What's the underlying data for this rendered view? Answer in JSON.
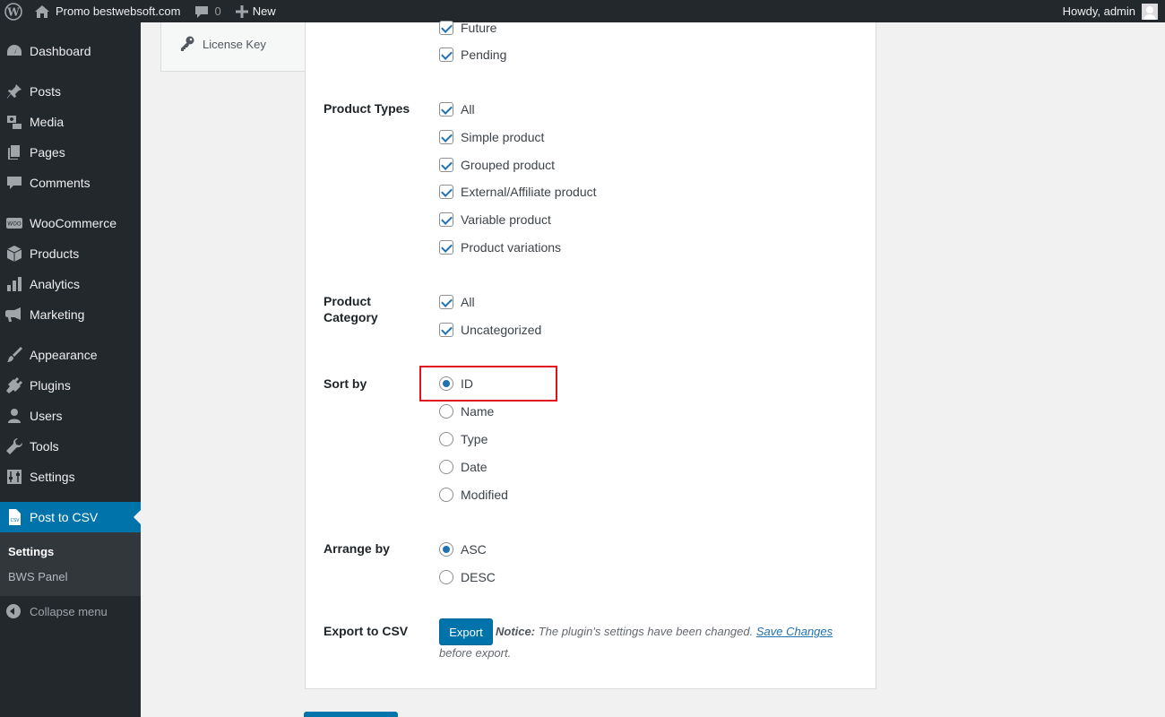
{
  "adminbar": {
    "site_name": "Promo bestwebsoft.com",
    "comments_count": "0",
    "new_label": "New",
    "howdy": "Howdy, admin"
  },
  "sidebar": {
    "items": [
      {
        "label": "Dashboard",
        "icon": "dashboard-icon"
      },
      {
        "label": "Posts",
        "icon": "pin-icon"
      },
      {
        "label": "Media",
        "icon": "media-icon"
      },
      {
        "label": "Pages",
        "icon": "pages-icon"
      },
      {
        "label": "Comments",
        "icon": "comment-icon"
      },
      {
        "label": "WooCommerce",
        "icon": "woo-icon"
      },
      {
        "label": "Products",
        "icon": "box-icon"
      },
      {
        "label": "Analytics",
        "icon": "bar-chart-icon"
      },
      {
        "label": "Marketing",
        "icon": "megaphone-icon"
      },
      {
        "label": "Appearance",
        "icon": "brush-icon"
      },
      {
        "label": "Plugins",
        "icon": "plug-icon"
      },
      {
        "label": "Users",
        "icon": "user-icon"
      },
      {
        "label": "Tools",
        "icon": "wrench-icon"
      },
      {
        "label": "Settings",
        "icon": "sliders-icon"
      },
      {
        "label": "Post to CSV",
        "icon": "csv-file-icon"
      }
    ],
    "submenu": [
      "Settings",
      "BWS Panel"
    ],
    "collapse": "Collapse menu"
  },
  "tabs": {
    "license": "License Key"
  },
  "form": {
    "post_status_opts": [
      "Future",
      "Pending"
    ],
    "product_types_label": "Product Types",
    "product_types": [
      "All",
      "Simple product",
      "Grouped product",
      "External/Affiliate product",
      "Variable product",
      "Product variations"
    ],
    "product_category_label": "Product Category",
    "product_category": [
      "All",
      "Uncategorized"
    ],
    "sort_by_label": "Sort by",
    "sort_by": [
      "ID",
      "Name",
      "Type",
      "Date",
      "Modified"
    ],
    "sort_by_selected": "ID",
    "arrange_by_label": "Arrange by",
    "arrange_by": [
      "ASC",
      "DESC"
    ],
    "arrange_by_selected": "ASC",
    "export_label": "Export to CSV",
    "export_button": "Export",
    "notice_prefix": "Notice:",
    "notice_text": "The plugin's settings have been changed.",
    "notice_link": "Save Changes",
    "notice_suffix": "before export."
  },
  "colors": {
    "accent": "#0073aa",
    "admin_dark": "#23282d",
    "highlight_box": "#e0141e"
  }
}
